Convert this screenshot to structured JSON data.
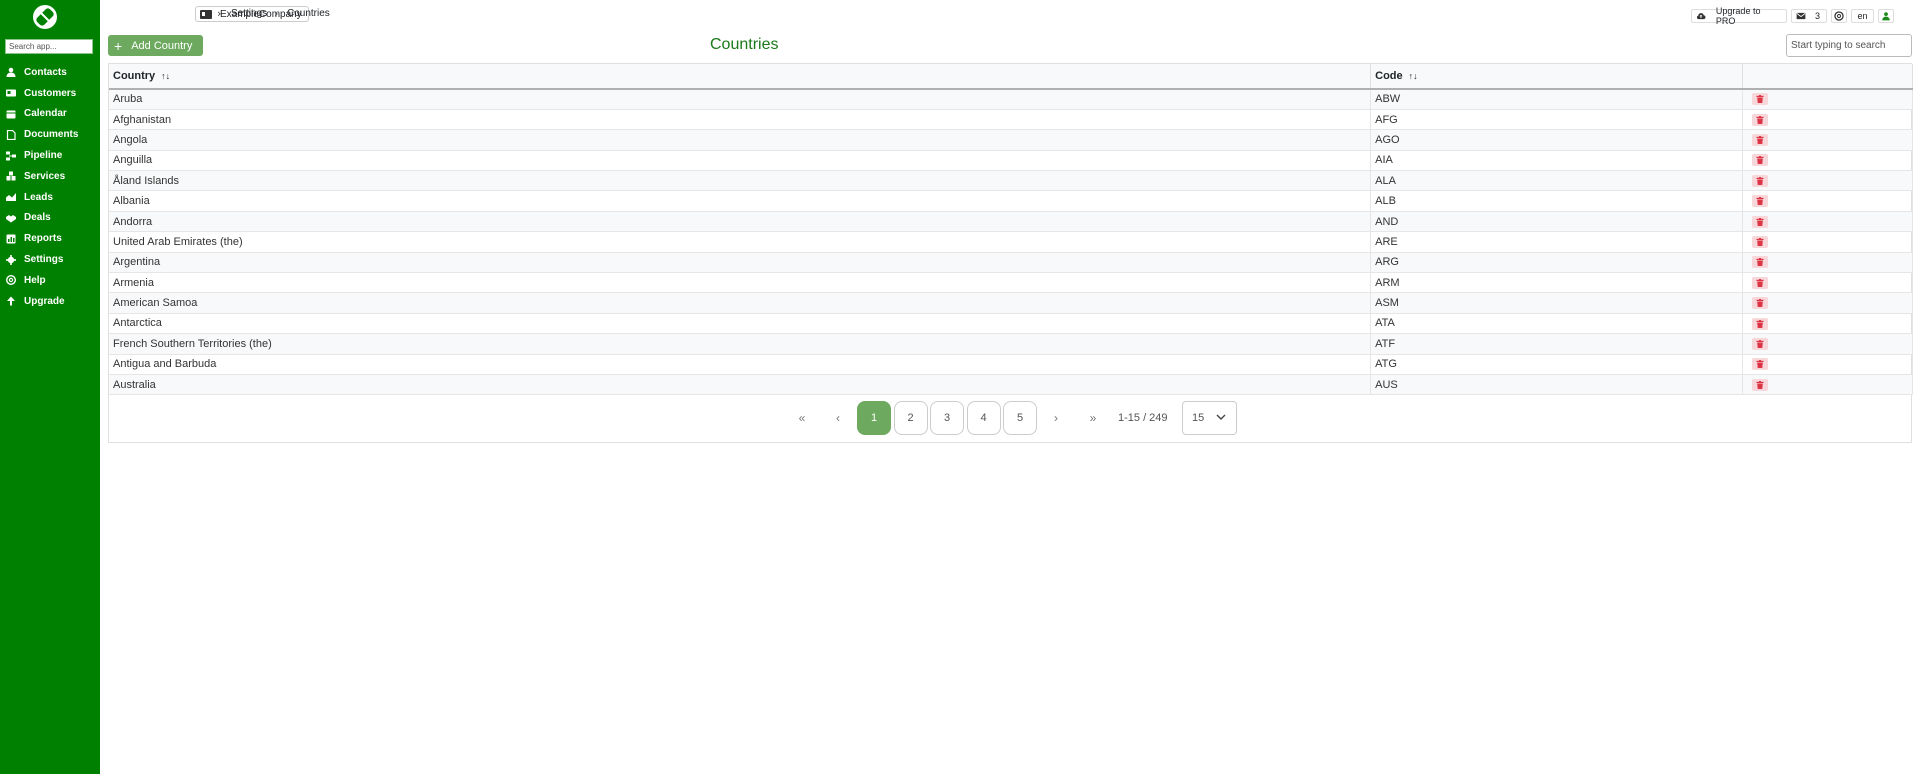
{
  "sidebar": {
    "search_placeholder": "Search app...",
    "items": [
      {
        "label": "Contacts",
        "icon": "person-icon"
      },
      {
        "label": "Customers",
        "icon": "id-card-icon"
      },
      {
        "label": "Calendar",
        "icon": "calendar-icon"
      },
      {
        "label": "Documents",
        "icon": "document-icon"
      },
      {
        "label": "Pipeline",
        "icon": "pipeline-icon"
      },
      {
        "label": "Services",
        "icon": "services-icon"
      },
      {
        "label": "Leads",
        "icon": "leads-icon"
      },
      {
        "label": "Deals",
        "icon": "handshake-icon"
      },
      {
        "label": "Reports",
        "icon": "report-icon"
      },
      {
        "label": "Settings",
        "icon": "gear-icon"
      },
      {
        "label": "Help",
        "icon": "help-icon"
      },
      {
        "label": "Upgrade",
        "icon": "arrow-up-icon"
      }
    ]
  },
  "breadcrumb": {
    "company": "ExampleCompany",
    "settings": "Settings",
    "current": "Countries"
  },
  "topbar": {
    "upgrade_label": "Upgrade to PRO",
    "mail_count": "3",
    "language": "en"
  },
  "toolbar": {
    "add_label": "Add Country",
    "title": "Countries",
    "search_placeholder": "Start typing to search"
  },
  "table": {
    "columns": [
      "Country",
      "Code"
    ],
    "rows": [
      {
        "country": "Aruba",
        "code": "ABW"
      },
      {
        "country": "Afghanistan",
        "code": "AFG"
      },
      {
        "country": "Angola",
        "code": "AGO"
      },
      {
        "country": "Anguilla",
        "code": "AIA"
      },
      {
        "country": "Åland Islands",
        "code": "ALA"
      },
      {
        "country": "Albania",
        "code": "ALB"
      },
      {
        "country": "Andorra",
        "code": "AND"
      },
      {
        "country": "United Arab Emirates (the)",
        "code": "ARE"
      },
      {
        "country": "Argentina",
        "code": "ARG"
      },
      {
        "country": "Armenia",
        "code": "ARM"
      },
      {
        "country": "American Samoa",
        "code": "ASM"
      },
      {
        "country": "Antarctica",
        "code": "ATA"
      },
      {
        "country": "French Southern Territories (the)",
        "code": "ATF"
      },
      {
        "country": "Antigua and Barbuda",
        "code": "ATG"
      },
      {
        "country": "Australia",
        "code": "AUS"
      }
    ]
  },
  "pagination": {
    "first": "«",
    "prev": "‹",
    "pages": [
      "1",
      "2",
      "3",
      "4",
      "5"
    ],
    "active_page": "1",
    "next": "›",
    "last": "»",
    "range": "1-15 / 249",
    "page_size": "15"
  },
  "colors": {
    "sidebar_bg": "#008000",
    "accent": "#6daa5f",
    "title": "#1a7a1a",
    "delete": "#dc3545"
  }
}
